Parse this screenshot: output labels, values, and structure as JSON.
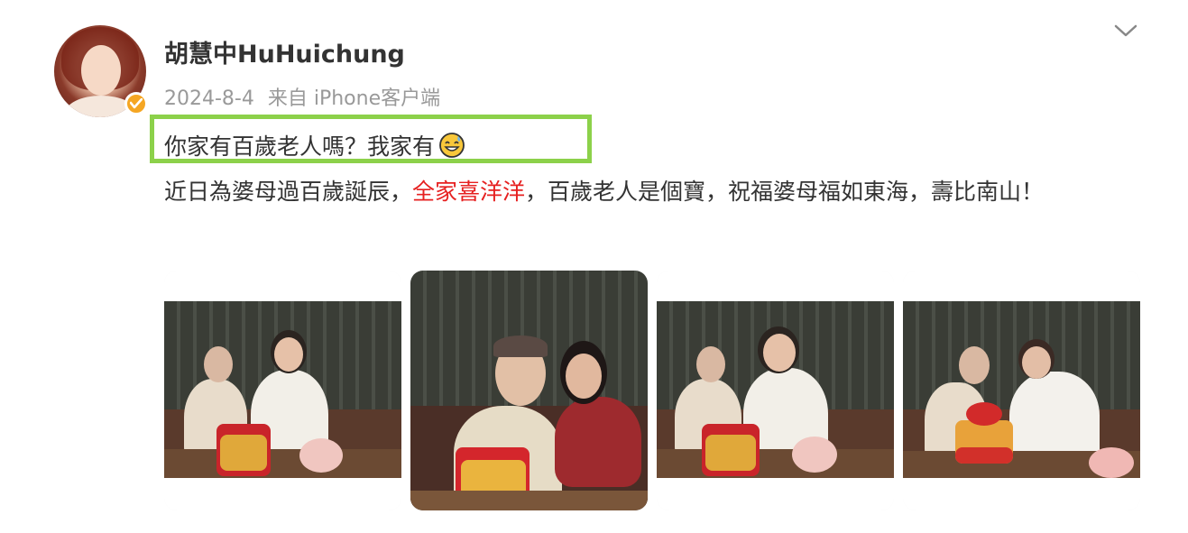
{
  "post": {
    "author": "胡慧中HuHuichung",
    "date": "2024-8-4",
    "source": "来自 iPhone客户端",
    "line1": "你家有百歲老人嗎？我家有",
    "body_part1": "近日為婆母過百歲誕辰，",
    "body_highlight": "全家喜洋洋",
    "body_part2": "，百歲老人是個寶，祝福婆母福如東海，壽比南山！"
  },
  "icons": {
    "verified": "verified-badge-icon",
    "more": "chevron-down-icon",
    "emoji": "sweat-smile-emoji"
  },
  "colors": {
    "highlight_border": "#8cd14a",
    "red_text": "#e62020",
    "verified": "#f5a623"
  },
  "photos": [
    {
      "name": "photo-1"
    },
    {
      "name": "photo-2"
    },
    {
      "name": "photo-3"
    },
    {
      "name": "photo-4"
    }
  ]
}
